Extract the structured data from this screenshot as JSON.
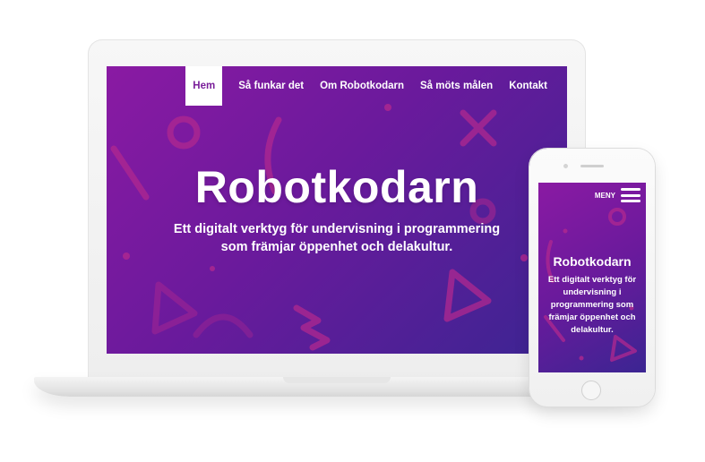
{
  "desktop": {
    "nav": {
      "items": [
        {
          "label": "Hem",
          "active": true
        },
        {
          "label": "Så funkar det",
          "active": false
        },
        {
          "label": "Om Robotkodarn",
          "active": false
        },
        {
          "label": "Så möts målen",
          "active": false
        },
        {
          "label": "Kontakt",
          "active": false
        }
      ]
    },
    "hero": {
      "title": "Robotkodarn",
      "subtitle_line1": "Ett digitalt verktyg för undervisning i programmering",
      "subtitle_line2": "som främjar öppenhet och delakultur."
    }
  },
  "mobile": {
    "menu_label": "MENY",
    "hero": {
      "title": "Robotkodarn",
      "subtitle": "Ett digitalt verktyg för undervisning i programmering som främjar öppenhet och delakultur."
    }
  },
  "colors": {
    "gradient_start": "#8a1aa3",
    "gradient_mid": "#6a1a9c",
    "gradient_end": "#3b2592",
    "active_nav_text": "#7a1f9a",
    "shape_color": "#b0288f"
  },
  "icons": {
    "menu": "hamburger-icon",
    "phone_button": "home-button-icon"
  }
}
